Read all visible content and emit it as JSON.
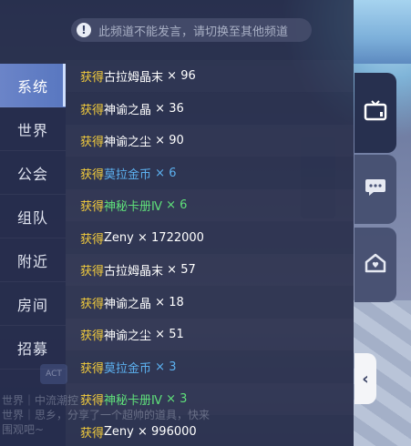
{
  "notice": {
    "icon": "exclamation-icon",
    "text": "此频道不能发言，请切换至其他频道"
  },
  "tabs": [
    {
      "label": "系统",
      "active": true
    },
    {
      "label": "世界",
      "active": false
    },
    {
      "label": "公会",
      "active": false
    },
    {
      "label": "组队",
      "active": false
    },
    {
      "label": "附近",
      "active": false
    },
    {
      "label": "房间",
      "active": false
    },
    {
      "label": "招募",
      "active": false
    }
  ],
  "messages": [
    {
      "prefix": "获得",
      "item": "古拉姆晶末",
      "qty": "× 96",
      "color": "white"
    },
    {
      "prefix": "获得",
      "item": "神谕之晶",
      "qty": "× 36",
      "color": "white"
    },
    {
      "prefix": "获得",
      "item": "神谕之尘",
      "qty": "× 90",
      "color": "white"
    },
    {
      "prefix": "获得",
      "item": "莫拉金币",
      "qty": "× 6",
      "color": "blue"
    },
    {
      "prefix": "获得",
      "item": "神秘卡册Ⅳ",
      "qty": "× 6",
      "color": "green"
    },
    {
      "prefix": "获得",
      "item": "Zeny",
      "qty": "× 1722000",
      "color": "white"
    },
    {
      "prefix": "获得",
      "item": "古拉姆晶末",
      "qty": "× 57",
      "color": "white"
    },
    {
      "prefix": "获得",
      "item": "神谕之晶",
      "qty": "× 18",
      "color": "white"
    },
    {
      "prefix": "获得",
      "item": "神谕之尘",
      "qty": "× 51",
      "color": "white"
    },
    {
      "prefix": "获得",
      "item": "莫拉金币",
      "qty": "× 3",
      "color": "blue"
    },
    {
      "prefix": "获得",
      "item": "神秘卡册Ⅳ",
      "qty": "× 3",
      "color": "green"
    },
    {
      "prefix": "获得",
      "item": "Zeny",
      "qty": "× 996000",
      "color": "white"
    }
  ],
  "background_chat": {
    "line1": "世界｜中流潮控",
    "line2": "世界｜思乡，分享了一个超帅的道具，快来",
    "line3": "围观吧~",
    "act_badge": "ACT"
  },
  "side_buttons": [
    {
      "icon": "tv-icon",
      "active": true
    },
    {
      "icon": "chat-bubble-icon",
      "active": false
    },
    {
      "icon": "home-icon",
      "active": false
    }
  ],
  "collapse": {
    "icon": "chevron-left-icon",
    "glyph": "‹"
  },
  "colors": {
    "prefix": "#f3cc3c",
    "white_item": "#ffffff",
    "blue_item": "#5cb1f0",
    "green_item": "#5fe07a",
    "tab_active": "#6b84c8"
  }
}
